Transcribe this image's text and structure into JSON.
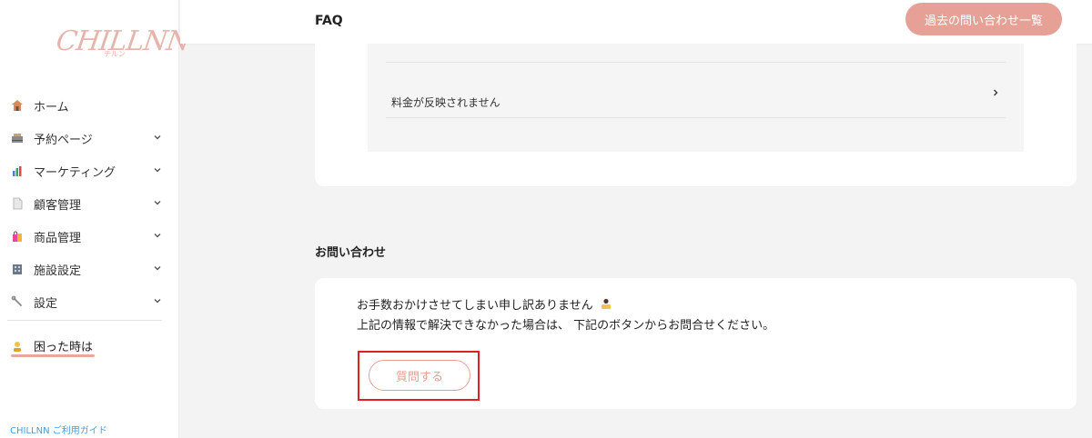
{
  "brand": {
    "logo_text": "CHILLNN",
    "logo_sub": "チルン",
    "accent": "#e6a096"
  },
  "sidebar": {
    "items": [
      {
        "label": "ホーム",
        "icon": "home-icon",
        "has_submenu": false
      },
      {
        "label": "予約ページ",
        "icon": "reservation-icon",
        "has_submenu": true
      },
      {
        "label": "マーケティング",
        "icon": "chart-icon",
        "has_submenu": true
      },
      {
        "label": "顧客管理",
        "icon": "document-icon",
        "has_submenu": true
      },
      {
        "label": "商品管理",
        "icon": "shopping-bag-icon",
        "has_submenu": true
      },
      {
        "label": "施設設定",
        "icon": "building-icon",
        "has_submenu": true
      },
      {
        "label": "設定",
        "icon": "wrench-icon",
        "has_submenu": true
      }
    ],
    "help_label": "困った時は",
    "guide_link": "CHILLNN ご利用ガイド"
  },
  "header": {
    "title": "FAQ",
    "history_button": "過去の問い合わせ一覧"
  },
  "faq": {
    "items": [
      {
        "question": "料金が反映されません"
      }
    ]
  },
  "contact": {
    "section_title": "お問い合わせ",
    "message_line1": "お手数おかけさせてしまい申し訳ありません",
    "message_line2": "上記の情報で解決できなかった場合は、 下記のボタンからお問合せください。",
    "ask_button": "質問する"
  }
}
